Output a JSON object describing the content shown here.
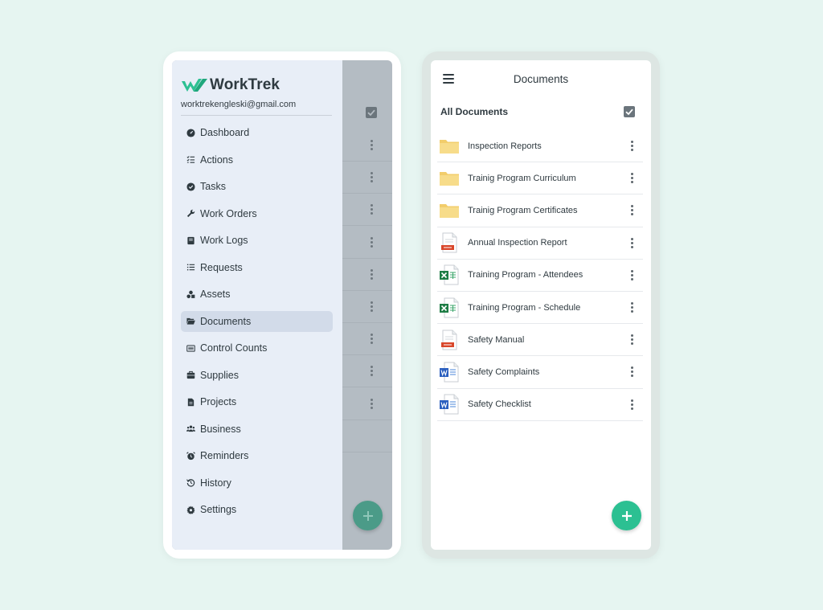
{
  "colors": {
    "background": "#e6f5f1",
    "brand_green": "#2cc092",
    "drawer_bg": "#e8eef7",
    "active_item_bg": "#d2dbe9",
    "overlay": "#b4bcc3"
  },
  "brand": {
    "name": "WorkTrek",
    "logo_icon": "worktrek-logo-icon"
  },
  "user": {
    "email": "worktrekengleski@gmail.com"
  },
  "menu": {
    "active": "Documents",
    "items": [
      {
        "label": "Dashboard",
        "icon": "dashboard-icon"
      },
      {
        "label": "Actions",
        "icon": "actions-list-icon"
      },
      {
        "label": "Tasks",
        "icon": "check-circle-icon"
      },
      {
        "label": "Work Orders",
        "icon": "wrench-icon"
      },
      {
        "label": "Work Logs",
        "icon": "book-icon"
      },
      {
        "label": "Requests",
        "icon": "list-icon"
      },
      {
        "label": "Assets",
        "icon": "shapes-icon"
      },
      {
        "label": "Documents",
        "icon": "folder-open-icon"
      },
      {
        "label": "Control Counts",
        "icon": "counter-icon"
      },
      {
        "label": "Supplies",
        "icon": "briefcase-icon"
      },
      {
        "label": "Projects",
        "icon": "file-icon"
      },
      {
        "label": "Business",
        "icon": "users-icon"
      },
      {
        "label": "Reminders",
        "icon": "alarm-clock-icon"
      },
      {
        "label": "History",
        "icon": "history-icon"
      },
      {
        "label": "Settings",
        "icon": "gear-icon"
      }
    ]
  },
  "documents_screen": {
    "title": "Documents",
    "section_title": "All Documents",
    "items": [
      {
        "name": "Inspection Reports",
        "type": "folder"
      },
      {
        "name": "Trainig Program Curriculum",
        "type": "folder"
      },
      {
        "name": "Trainig Program Certificates",
        "type": "folder"
      },
      {
        "name": "Annual Inspection Report",
        "type": "pdf"
      },
      {
        "name": "Training Program - Attendees",
        "type": "excel"
      },
      {
        "name": "Training Program - Schedule",
        "type": "excel"
      },
      {
        "name": "Safety Manual",
        "type": "pdf"
      },
      {
        "name": "Safety Complaints",
        "type": "word"
      },
      {
        "name": "Safety Checklist",
        "type": "word"
      }
    ]
  },
  "fab_icon": "plus-icon"
}
